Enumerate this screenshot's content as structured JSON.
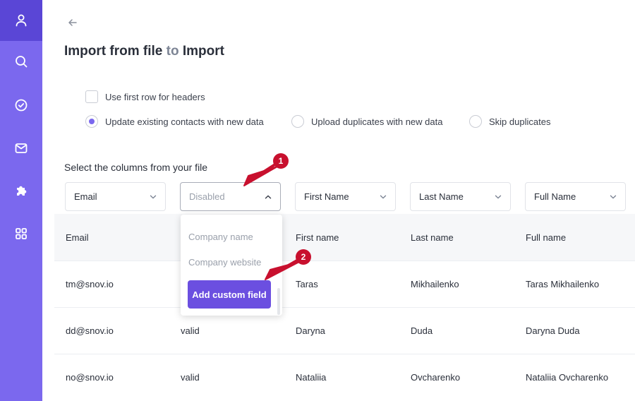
{
  "sidebar": {
    "items": [
      {
        "icon": "user-icon",
        "active": true
      },
      {
        "icon": "search-icon",
        "active": false
      },
      {
        "icon": "check-circle-icon",
        "active": false
      },
      {
        "icon": "mail-icon",
        "active": false
      },
      {
        "icon": "puzzle-icon",
        "active": false
      },
      {
        "icon": "grid-icon",
        "active": false
      }
    ]
  },
  "header": {
    "title_prefix": "Import from file",
    "title_connector": "to",
    "title_suffix": "Import"
  },
  "options": {
    "first_row_headers": {
      "label": "Use first row for headers",
      "checked": false
    },
    "duplicates": [
      {
        "label": "Update existing contacts with new data",
        "checked": true
      },
      {
        "label": "Upload duplicates with new data",
        "checked": false
      },
      {
        "label": "Skip duplicates",
        "checked": false
      }
    ]
  },
  "columns_section": {
    "label": "Select the columns from your file",
    "selects": [
      {
        "value": "Email",
        "open": false
      },
      {
        "value": "Disabled",
        "open": true
      },
      {
        "value": "First Name",
        "open": false
      },
      {
        "value": "Last Name",
        "open": false
      },
      {
        "value": "Full Name",
        "open": false
      }
    ]
  },
  "dropdown": {
    "items": [
      "Company name",
      "Company website"
    ],
    "add_button": "Add custom field"
  },
  "table": {
    "header": [
      "Email",
      "",
      "First name",
      "Last name",
      "Full name"
    ],
    "rows": [
      [
        "tm@snov.io",
        "",
        "Taras",
        "Mikhailenko",
        "Taras Mikhailenko"
      ],
      [
        "dd@snov.io",
        "valid",
        "Daryna",
        "Duda",
        "Daryna Duda"
      ],
      [
        "no@snov.io",
        "valid",
        "Nataliia",
        "Ovcharenko",
        "Nataliia Ovcharenko"
      ]
    ]
  },
  "callouts": [
    "1",
    "2"
  ],
  "colors": {
    "sidebar": "#7b68ee",
    "sidebar_active": "#5a46d6",
    "accent": "#6b4fe0",
    "callout": "#c8102e"
  }
}
